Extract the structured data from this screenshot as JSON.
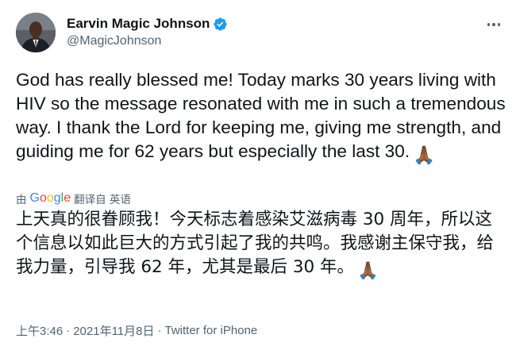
{
  "author": {
    "display_name": "Earvin Magic Johnson",
    "handle": "@MagicJohnson",
    "verified": true,
    "verified_icon": "verified-badge-icon"
  },
  "tweet": {
    "text": "God has really blessed me! Today marks 30 years living with HIV so the message resonated with me in such a tremendous way. I thank the Lord for keeping me, giving me strength, and guiding me for 62 years but especially the last 30.",
    "emoji": "🙏🏾"
  },
  "translation": {
    "by_label": "由",
    "provider": "Google",
    "link_label": "翻译自 英语",
    "text": "上天真的很眷顾我！今天标志着感染艾滋病毒 30 周年，所以这个信息以如此巨大的方式引起了我的共鸣。我感谢主保守我，给我力量，引导我 62 年，尤其是最后 30 年。",
    "emoji": "🙏🏾"
  },
  "meta": {
    "time": "上午3:46",
    "separator": "·",
    "date": "2021年11月8日",
    "source": "Twitter for iPhone"
  },
  "colors": {
    "text": "#0f1419",
    "secondary": "#536471",
    "verified": "#1d9bf0",
    "google_blue": "#4285f4",
    "google_red": "#ea4335",
    "google_yellow": "#fbbc05",
    "google_green": "#34a853"
  }
}
